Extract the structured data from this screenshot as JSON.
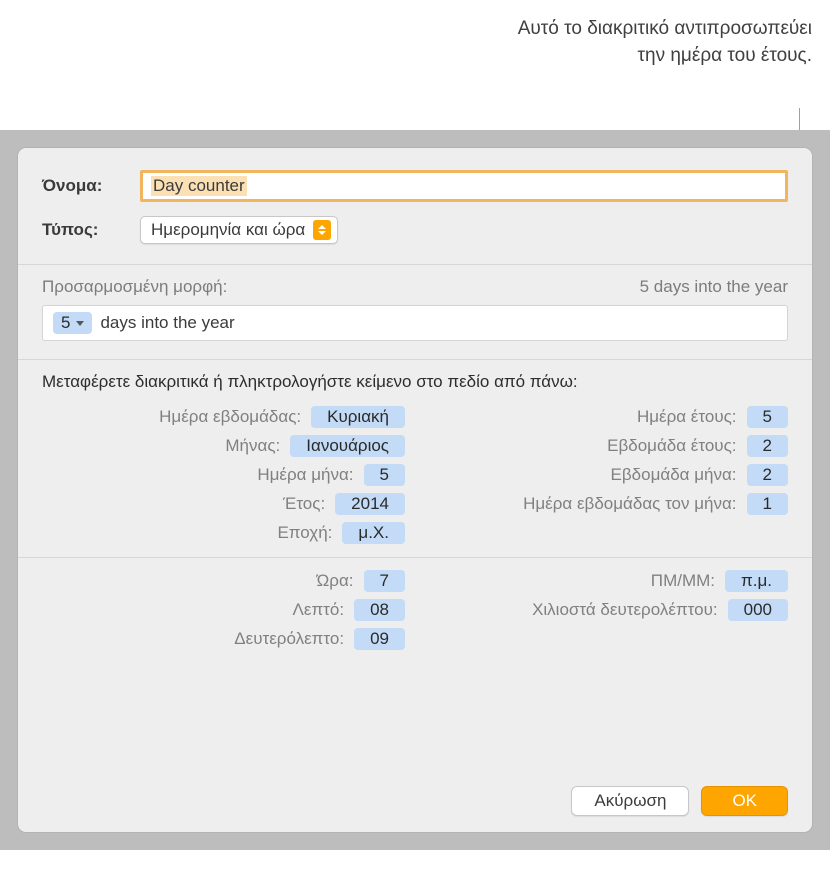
{
  "callout": "Αυτό το διακριτικό αντιπροσωπεύει την ημέρα του έτους.",
  "labels": {
    "name": "Όνομα:",
    "type": "Τύπος:"
  },
  "name_value": "Day counter",
  "type_value": "Ημερομηνία και ώρα",
  "custom_format_label": "Προσαρμοσμένη μορφή:",
  "preview": "5 days into the year",
  "format_token": "5",
  "format_suffix": "days into the year",
  "drag_instructions": "Μεταφέρετε διακριτικά ή πληκτρολογήστε κείμενο στο πεδίο από πάνω:",
  "date_tokens_left": [
    {
      "label": "Ημέρα εβδομάδας:",
      "value": "Κυριακή"
    },
    {
      "label": "Μήνας:",
      "value": "Ιανουάριος"
    },
    {
      "label": "Ημέρα μήνα:",
      "value": "5"
    },
    {
      "label": "Έτος:",
      "value": "2014"
    },
    {
      "label": "Εποχή:",
      "value": "μ.Χ."
    }
  ],
  "date_tokens_right": [
    {
      "label": "Ημέρα έτους:",
      "value": "5"
    },
    {
      "label": "Εβδομάδα έτους:",
      "value": "2"
    },
    {
      "label": "Εβδομάδα μήνα:",
      "value": "2"
    },
    {
      "label": "Ημέρα εβδομάδας τον μήνα:",
      "value": "1"
    }
  ],
  "time_tokens_left": [
    {
      "label": "Ώρα:",
      "value": "7"
    },
    {
      "label": "Λεπτό:",
      "value": "08"
    },
    {
      "label": "Δευτερόλεπτο:",
      "value": "09"
    }
  ],
  "time_tokens_right": [
    {
      "label": "ΠΜ/ΜΜ:",
      "value": "π.μ."
    },
    {
      "label": "Χιλιοστά δευτερολέπτου:",
      "value": "000"
    }
  ],
  "buttons": {
    "cancel": "Ακύρωση",
    "ok": "OK"
  }
}
